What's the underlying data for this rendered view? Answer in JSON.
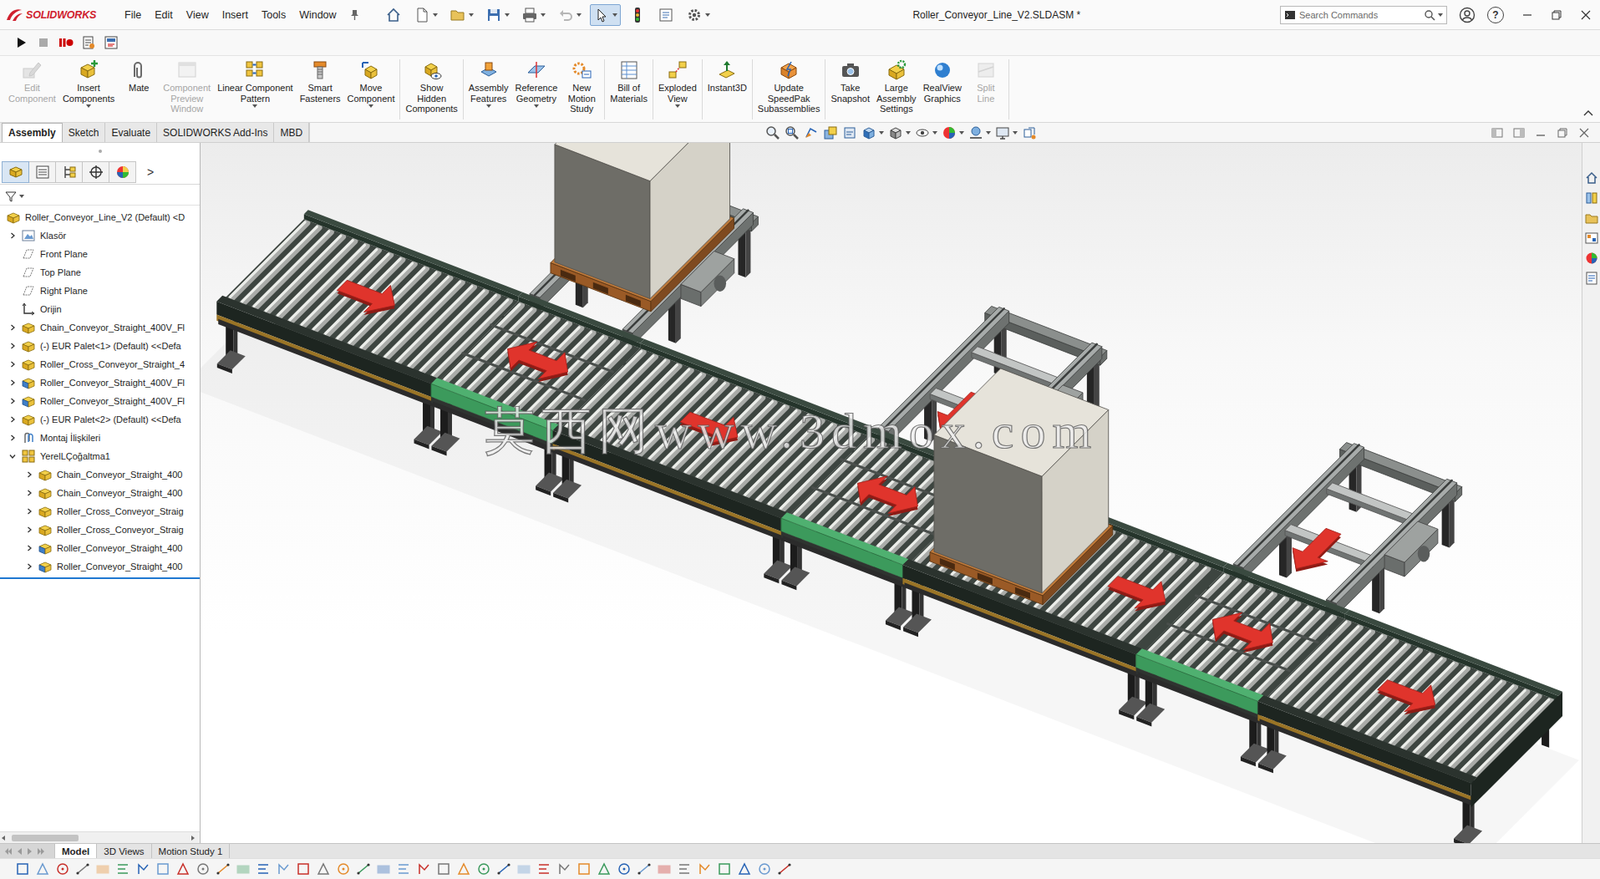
{
  "window": {
    "title": "Roller_Conveyor_Line_V2.SLDASM *",
    "app": "SOLIDWORKS"
  },
  "menu": [
    "File",
    "Edit",
    "View",
    "Insert",
    "Tools",
    "Window"
  ],
  "quick_access": [
    {
      "selected": false,
      "disabled": false,
      "dropdown": false
    },
    {
      "selected": false,
      "disabled": false,
      "dropdown": true
    },
    {
      "selected": false,
      "disabled": false,
      "dropdown": true
    },
    {
      "selected": false,
      "disabled": false,
      "dropdown": true
    },
    {
      "selected": false,
      "disabled": false,
      "dropdown": true
    },
    {
      "selected": false,
      "disabled": true,
      "dropdown": true
    },
    {
      "selected": true,
      "disabled": false,
      "dropdown": true
    },
    {
      "selected": false,
      "disabled": false,
      "dropdown": false
    },
    {
      "selected": false,
      "disabled": false,
      "dropdown": false
    },
    {
      "selected": false,
      "disabled": false,
      "dropdown": true
    }
  ],
  "search": {
    "placeholder": "Search Commands"
  },
  "title_icons": {
    "help": "?"
  },
  "ribbon": {
    "groups": [
      {
        "buttons": [
          {
            "lines": [
              "Edit",
              "Component"
            ],
            "disabled": true,
            "dropdown": false
          },
          {
            "lines": [
              "Insert",
              "Components"
            ],
            "disabled": false,
            "dropdown": true
          },
          {
            "lines": [
              "Mate"
            ],
            "disabled": false,
            "dropdown": false
          },
          {
            "lines": [
              "Component",
              "Preview",
              "Window"
            ],
            "disabled": true,
            "dropdown": false
          },
          {
            "lines": [
              "Linear Component",
              "Pattern"
            ],
            "disabled": false,
            "dropdown": true
          },
          {
            "lines": [
              "Smart",
              "Fasteners"
            ],
            "disabled": false,
            "dropdown": false
          },
          {
            "lines": [
              "Move",
              "Component"
            ],
            "disabled": false,
            "dropdown": true
          }
        ]
      },
      {
        "buttons": [
          {
            "lines": [
              "Show",
              "Hidden",
              "Components"
            ],
            "disabled": false,
            "dropdown": false
          }
        ]
      },
      {
        "buttons": [
          {
            "lines": [
              "Assembly",
              "Features"
            ],
            "disabled": false,
            "dropdown": true
          },
          {
            "lines": [
              "Reference",
              "Geometry"
            ],
            "disabled": false,
            "dropdown": true
          },
          {
            "lines": [
              "New",
              "Motion",
              "Study"
            ],
            "disabled": false,
            "dropdown": false
          }
        ]
      },
      {
        "buttons": [
          {
            "lines": [
              "Bill of",
              "Materials"
            ],
            "disabled": false,
            "dropdown": false
          }
        ]
      },
      {
        "buttons": [
          {
            "lines": [
              "Exploded",
              "View"
            ],
            "disabled": false,
            "dropdown": true
          }
        ]
      },
      {
        "buttons": [
          {
            "lines": [
              "Instant3D"
            ],
            "disabled": false,
            "dropdown": false
          }
        ]
      },
      {
        "buttons": [
          {
            "lines": [
              "Update",
              "SpeedPak",
              "Subassemblies"
            ],
            "disabled": false,
            "dropdown": false
          }
        ]
      },
      {
        "buttons": [
          {
            "lines": [
              "Take",
              "Snapshot"
            ],
            "disabled": false,
            "dropdown": false
          },
          {
            "lines": [
              "Large",
              "Assembly",
              "Settings"
            ],
            "disabled": false,
            "dropdown": false
          },
          {
            "lines": [
              "RealView",
              "Graphics"
            ],
            "disabled": false,
            "dropdown": false
          },
          {
            "lines": [
              "Split",
              "Line"
            ],
            "disabled": true,
            "dropdown": false
          }
        ]
      }
    ]
  },
  "command_tabs": [
    {
      "label": "Assembly",
      "selected": true
    },
    {
      "label": "Sketch",
      "selected": false
    },
    {
      "label": "Evaluate",
      "selected": false
    },
    {
      "label": "SOLIDWORKS Add-Ins",
      "selected": false
    },
    {
      "label": "MBD",
      "selected": false
    }
  ],
  "panel_tabs": [
    {
      "selected": true
    },
    {
      "selected": false
    },
    {
      "selected": false
    },
    {
      "selected": false
    },
    {
      "selected": false
    }
  ],
  "panel_more": ">",
  "tree": [
    {
      "label": "Roller_Conveyor_Line_V2 (Default) <D",
      "level": 0,
      "expandable": false,
      "kind": "root"
    },
    {
      "label": "Klasör",
      "level": 0,
      "expandable": true,
      "expanded": false,
      "kind": "folder"
    },
    {
      "label": "Front Plane",
      "level": 0,
      "expandable": false,
      "kind": "plane"
    },
    {
      "label": "Top Plane",
      "level": 0,
      "expandable": false,
      "kind": "plane"
    },
    {
      "label": "Right Plane",
      "level": 0,
      "expandable": false,
      "kind": "plane"
    },
    {
      "label": "Orijin",
      "level": 0,
      "expandable": false,
      "kind": "origin"
    },
    {
      "label": "Chain_Conveyor_Straight_400V_Fl",
      "level": 0,
      "expandable": true,
      "expanded": false,
      "kind": "assembly"
    },
    {
      "label": "(-) EUR Palet<1> (Default) <<Defa",
      "level": 0,
      "expandable": true,
      "expanded": false,
      "kind": "assembly"
    },
    {
      "label": "Roller_Cross_Conveyor_Straight_4",
      "level": 0,
      "expandable": true,
      "expanded": false,
      "kind": "assembly"
    },
    {
      "label": "Roller_Conveyor_Straight_400V_Fl",
      "level": 0,
      "expandable": true,
      "expanded": false,
      "kind": "assembly-alt"
    },
    {
      "label": "Roller_Conveyor_Straight_400V_Fl",
      "level": 0,
      "expandable": true,
      "expanded": false,
      "kind": "assembly-alt"
    },
    {
      "label": "(-) EUR Palet<2> (Default) <<Defa",
      "level": 0,
      "expandable": true,
      "expanded": false,
      "kind": "assembly"
    },
    {
      "label": "Montaj İlişkileri",
      "level": 0,
      "expandable": true,
      "expanded": false,
      "kind": "mates"
    },
    {
      "label": "YerelLÇoğaltma1",
      "level": 0,
      "expandable": true,
      "expanded": true,
      "kind": "pattern"
    },
    {
      "label": "Chain_Conveyor_Straight_400",
      "level": 1,
      "expandable": true,
      "expanded": false,
      "kind": "assembly"
    },
    {
      "label": "Chain_Conveyor_Straight_400",
      "level": 1,
      "expandable": true,
      "expanded": false,
      "kind": "assembly"
    },
    {
      "label": "Roller_Cross_Conveyor_Straig",
      "level": 1,
      "expandable": true,
      "expanded": false,
      "kind": "assembly"
    },
    {
      "label": "Roller_Cross_Conveyor_Straig",
      "level": 1,
      "expandable": true,
      "expanded": false,
      "kind": "assembly"
    },
    {
      "label": "Roller_Conveyor_Straight_400",
      "level": 1,
      "expandable": true,
      "expanded": false,
      "kind": "assembly-alt"
    },
    {
      "label": "Roller_Conveyor_Straight_400",
      "level": 1,
      "expandable": true,
      "expanded": false,
      "kind": "assembly-alt"
    }
  ],
  "watermark": "莫西网www.3dmox.com",
  "bottom_tabs": [
    {
      "label": "Model",
      "selected": true
    },
    {
      "label": "3D Views",
      "selected": false
    },
    {
      "label": "Motion Study 1",
      "selected": false
    }
  ]
}
